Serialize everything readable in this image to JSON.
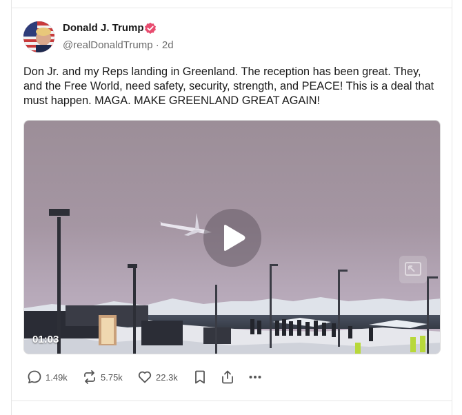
{
  "post": {
    "author": {
      "name": "Donald J. Trump",
      "handle": "@realDonaldTrump",
      "timestamp": "2d",
      "separator": "·",
      "verified": true
    },
    "text": "Don Jr. and my Reps landing in Greenland. The reception has been great. They, and the Free World, need safety, security, strength, and PEACE! This is a deal that must happen. MAGA. MAKE GREENLAND GREAT AGAIN!",
    "media": {
      "type": "video",
      "duration": "01:03",
      "icons": [
        "play-icon",
        "picture-in-picture-icon"
      ]
    },
    "actions": {
      "replies": "1.49k",
      "retruths": "5.75k",
      "likes": "22.3k",
      "icons": [
        "reply-icon",
        "retruth-icon",
        "heart-icon",
        "bookmark-icon",
        "share-icon",
        "more-icon"
      ]
    }
  },
  "colors": {
    "verified_badge": "#e84c6f",
    "icon_gray": "#555555",
    "text": "#1a1a1a",
    "muted": "#6b6b6b"
  }
}
